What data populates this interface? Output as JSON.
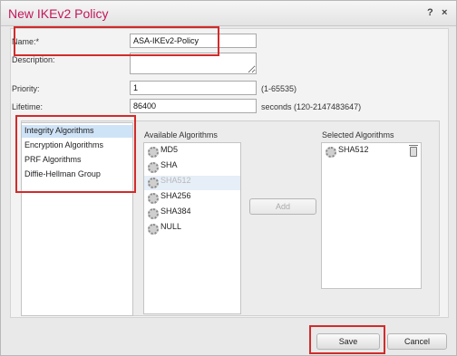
{
  "dialog": {
    "title": "New IKEv2 Policy",
    "help_glyph": "?",
    "close_glyph": "×"
  },
  "form": {
    "name_label": "Name:*",
    "name_value": "ASA-IKEv2-Policy",
    "description_label": "Description:",
    "description_value": "",
    "priority_label": "Priority:",
    "priority_value": "1",
    "priority_hint": "(1-65535)",
    "lifetime_label": "Lifetime:",
    "lifetime_value": "86400",
    "lifetime_hint": "seconds (120-2147483647)"
  },
  "nav": {
    "items": [
      {
        "label": "Integrity Algorithms",
        "selected": true
      },
      {
        "label": "Encryption Algorithms"
      },
      {
        "label": "PRF Algorithms"
      },
      {
        "label": "Diffie-Hellman Group"
      }
    ]
  },
  "available": {
    "header": "Available Algorithms",
    "items": [
      {
        "label": "MD5"
      },
      {
        "label": "SHA"
      },
      {
        "label": "SHA512",
        "disabled": true
      },
      {
        "label": "SHA256"
      },
      {
        "label": "SHA384"
      },
      {
        "label": "NULL"
      }
    ]
  },
  "add_button": "Add",
  "selected": {
    "header": "Selected Algorithms",
    "items": [
      {
        "label": "SHA512"
      }
    ]
  },
  "footer": {
    "save_label": "Save",
    "cancel_label": "Cancel"
  },
  "colors": {
    "title": "#c2185b",
    "highlight": "#d22b2b",
    "selected_row": "#cfe3f7"
  },
  "icons": {
    "algorithm": "gear-icon",
    "remove": "trash-icon"
  }
}
